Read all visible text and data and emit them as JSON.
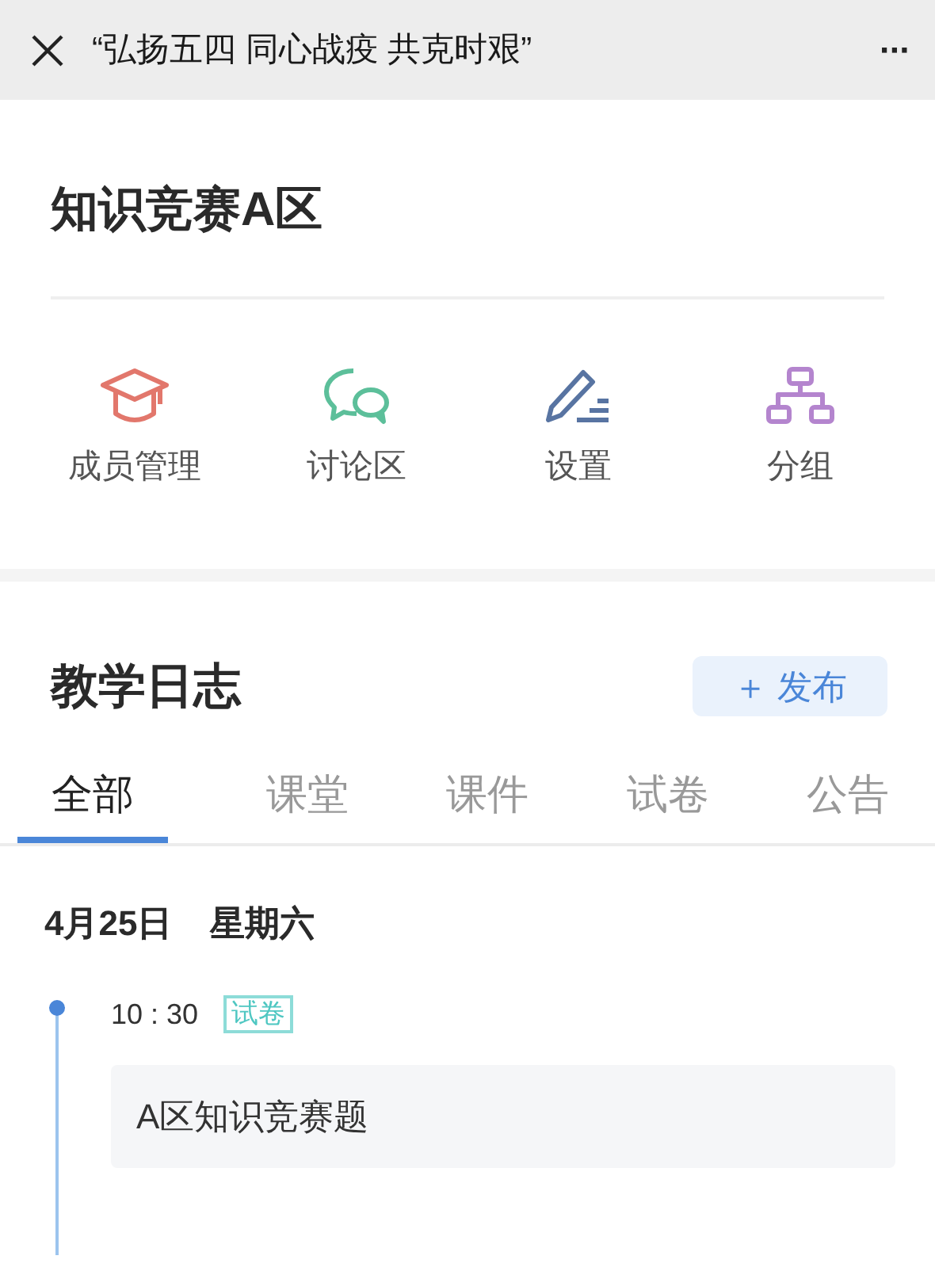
{
  "top_bar": {
    "title": "“弘扬五四 同心战疫 共克时艰”",
    "more": "···"
  },
  "course": {
    "title": "知识竞赛A区"
  },
  "actions": [
    {
      "label": "成员管理"
    },
    {
      "label": "讨论区"
    },
    {
      "label": "设置"
    },
    {
      "label": "分组"
    }
  ],
  "log": {
    "title": "教学日志",
    "publish_button": "＋ 发布"
  },
  "tabs": [
    {
      "label": "全部",
      "selected": true
    },
    {
      "label": "课堂",
      "selected": false
    },
    {
      "label": "课件",
      "selected": false
    },
    {
      "label": "试卷",
      "selected": false
    },
    {
      "label": "公告",
      "selected": false
    }
  ],
  "days": [
    {
      "date": "4月25日",
      "weekday": "星期六",
      "entries": [
        {
          "time": "10 : 30",
          "tag": "试卷",
          "title": "A区知识竞赛题"
        }
      ]
    }
  ]
}
